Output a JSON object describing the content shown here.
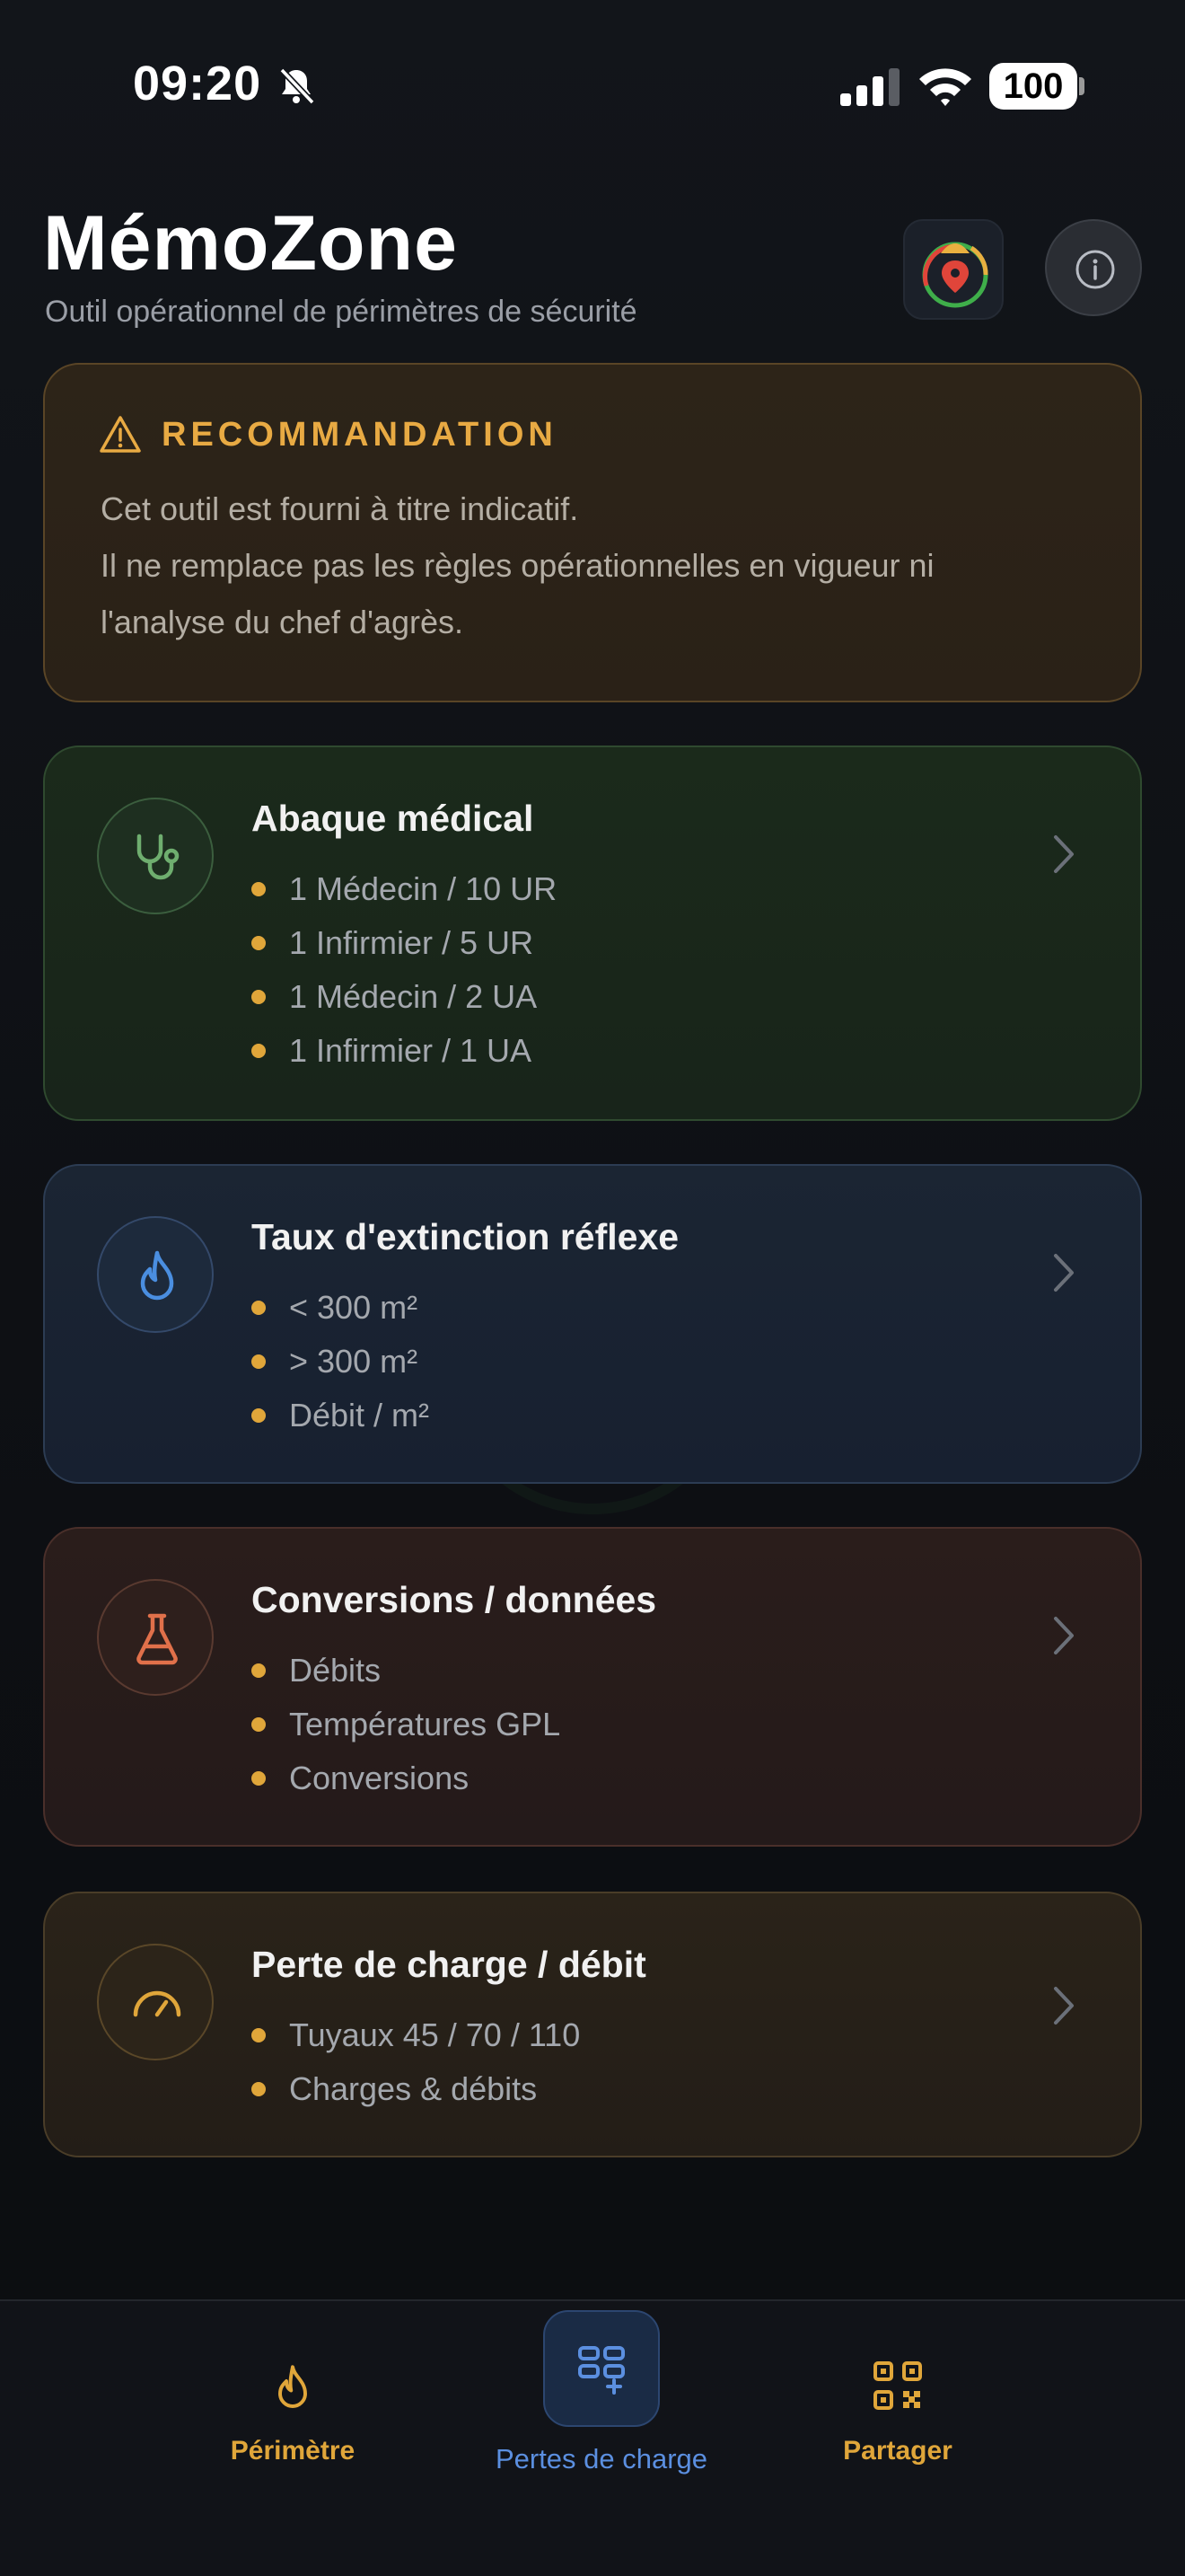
{
  "status_bar": {
    "time": "09:20",
    "battery": "100",
    "icons": [
      "bell-slash-icon",
      "cellular-signal-icon",
      "wifi-icon",
      "battery-icon"
    ]
  },
  "header": {
    "title": "MémoZone",
    "subtitle": "Outil opérationnel de périmètres de sécurité",
    "logo_icon": "app-logo-icon",
    "info_icon": "info-icon"
  },
  "warning": {
    "icon": "warning-triangle-icon",
    "title": "RECOMMANDATION",
    "lines": [
      "Cet outil est fourni à titre indicatif.",
      "Il ne remplace pas les règles opérationnelles en vigueur ni",
      "l'analyse du chef d'agrès."
    ]
  },
  "cards": [
    {
      "icon": "stethoscope-icon",
      "title": "Abaque médical",
      "items": [
        "1 Médecin / 10 UR",
        "1 Infirmier / 5 UR",
        "1 Médecin / 2 UA",
        "1 Infirmier / 1 UA"
      ],
      "accent": "#6fae6f"
    },
    {
      "icon": "flame-icon",
      "title": "Taux d'extinction réflexe",
      "items": [
        "< 300 m²",
        "> 300 m²",
        "Débit / m²"
      ],
      "accent": "#4a8ee0"
    },
    {
      "icon": "flask-icon",
      "title": "Conversions / données",
      "items": [
        "Débits",
        "Températures GPL",
        "Conversions"
      ],
      "accent": "#e0704a"
    },
    {
      "icon": "gauge-icon",
      "title": "Perte de charge / débit",
      "items": [
        "Tuyaux 45 / 70 / 110",
        "Charges & débits"
      ],
      "accent": "#e0a63a"
    }
  ],
  "tabs": [
    {
      "label": "Périmètre",
      "icon": "flame-icon",
      "color": "#e0a63a"
    },
    {
      "label": "Pertes de charge",
      "icon": "grid-plus-icon",
      "color": "#5b8fe0",
      "active": true
    },
    {
      "label": "Partager",
      "icon": "qr-code-icon",
      "color": "#e0a63a"
    }
  ]
}
